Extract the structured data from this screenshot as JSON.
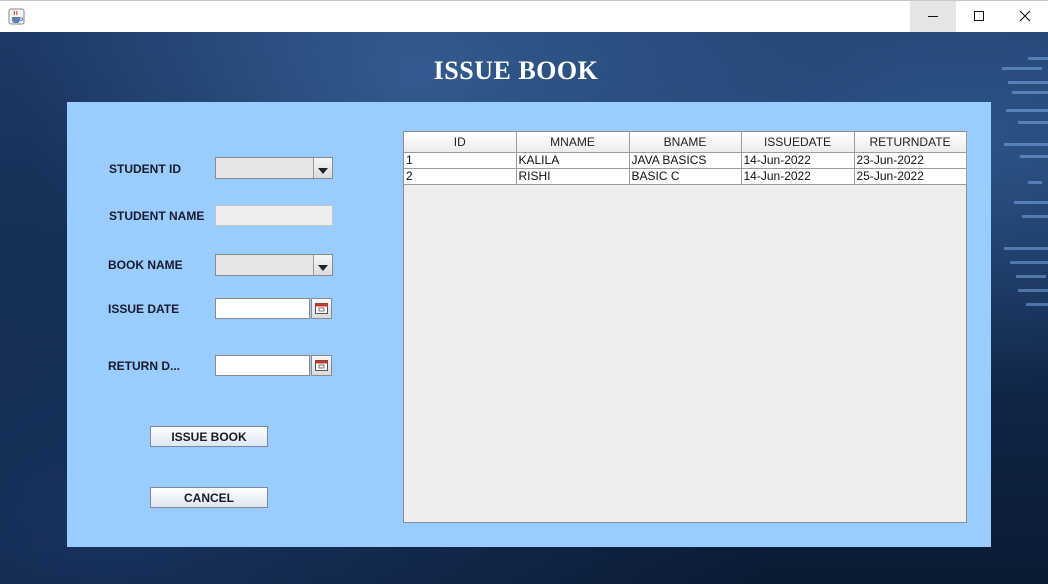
{
  "page": {
    "title": "ISSUE BOOK"
  },
  "window": {
    "icons": {
      "app": "java-cup-icon",
      "minimize": "minimize-icon",
      "maximize": "maximize-icon",
      "close": "close-icon"
    }
  },
  "form": {
    "student_id": {
      "label": "STUDENT ID",
      "value": ""
    },
    "student_name": {
      "label": "STUDENT NAME",
      "value": ""
    },
    "book_name": {
      "label": "BOOK NAME",
      "value": ""
    },
    "issue_date": {
      "label": "ISSUE DATE",
      "value": ""
    },
    "return_date": {
      "label": "RETURN D...",
      "value": ""
    }
  },
  "buttons": {
    "issue": "ISSUE BOOK",
    "cancel": "CANCEL"
  },
  "table": {
    "columns": [
      "ID",
      "MNAME",
      "BNAME",
      "ISSUEDATE",
      "RETURNDATE"
    ],
    "rows": [
      [
        "1",
        "KALILA",
        "JAVA BASICS",
        "14-Jun-2022",
        "23-Jun-2022"
      ],
      [
        "2",
        "RISHI",
        "BASIC C",
        "14-Jun-2022",
        "25-Jun-2022"
      ]
    ]
  },
  "colors": {
    "panel": "#99ccff",
    "backdrop": "#12294c"
  }
}
